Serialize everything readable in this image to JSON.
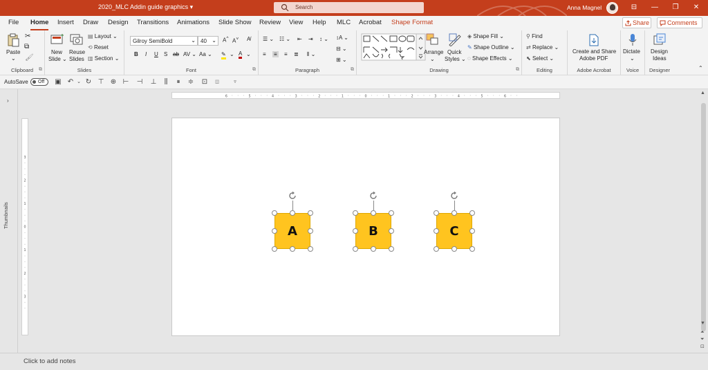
{
  "titlebar": {
    "doc_title": "2020_MLC Addin guide graphics",
    "search_placeholder": "Search",
    "user_name": "Anna Magnel",
    "accent_color": "#c43e1c"
  },
  "tabs": [
    {
      "label": "File"
    },
    {
      "label": "Home"
    },
    {
      "label": "Insert"
    },
    {
      "label": "Draw"
    },
    {
      "label": "Design"
    },
    {
      "label": "Transitions"
    },
    {
      "label": "Animations"
    },
    {
      "label": "Slide Show"
    },
    {
      "label": "Review"
    },
    {
      "label": "View"
    },
    {
      "label": "Help"
    },
    {
      "label": "MLC"
    },
    {
      "label": "Acrobat"
    },
    {
      "label": "Shape Format"
    }
  ],
  "share_label": "Share",
  "comments_label": "Comments",
  "ribbon": {
    "clipboard": {
      "label": "Clipboard",
      "paste": "Paste"
    },
    "slides": {
      "label": "Slides",
      "new_slide": "New",
      "new_slide2": "Slide",
      "reuse": "Reuse",
      "reuse2": "Slides",
      "layout": "Layout",
      "reset": "Reset",
      "section": "Section"
    },
    "font": {
      "label": "Font",
      "font_name": "Gilroy SemiBold",
      "font_size": "40"
    },
    "paragraph": {
      "label": "Paragraph"
    },
    "drawing": {
      "label": "Drawing",
      "arrange": "Arrange",
      "quick": "Quick",
      "styles": "Styles",
      "fill": "Shape Fill",
      "outline": "Shape Outline",
      "effects": "Shape Effects"
    },
    "editing": {
      "label": "Editing",
      "find": "Find",
      "replace": "Replace",
      "select": "Select"
    },
    "acrobat": {
      "label": "Adobe Acrobat",
      "create": "Create and Share",
      "create2": "Adobe PDF"
    },
    "voice": {
      "label": "Voice",
      "dictate": "Dictate"
    },
    "designer": {
      "label": "Designer",
      "ideas": "Design",
      "ideas2": "Ideas"
    }
  },
  "qat": {
    "autosave": "AutoSave",
    "toggle": "Off"
  },
  "thumbnails_label": "Thumbnails",
  "slide": {
    "shapes": [
      {
        "letter": "A",
        "color": "#ffc41f"
      },
      {
        "letter": "B",
        "color": "#ffc41f"
      },
      {
        "letter": "C",
        "color": "#ffc41f"
      }
    ]
  },
  "notes_placeholder": "Click to add notes"
}
